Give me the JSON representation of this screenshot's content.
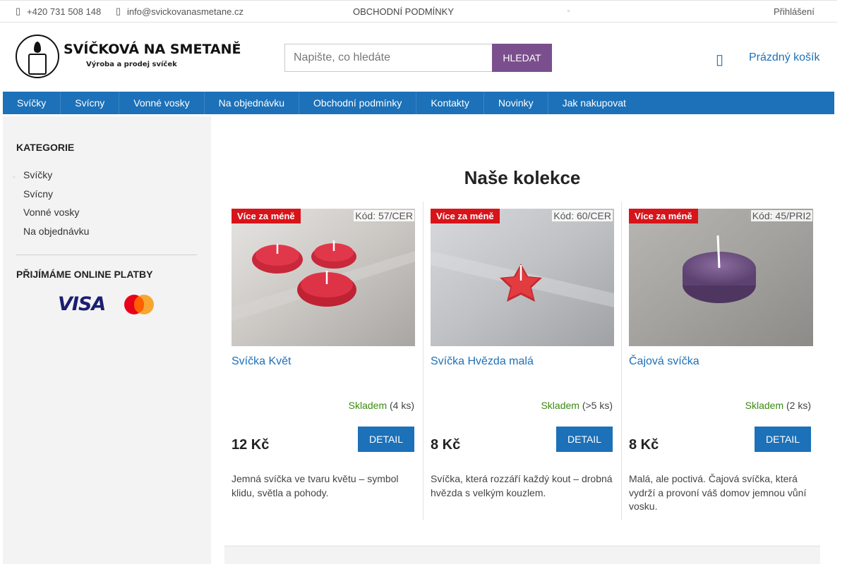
{
  "topbar": {
    "phone": "+420 731 508 148",
    "email": "info@svickovanasmetane.cz",
    "conditions": "OBCHODNÍ PODMÍNKY",
    "login": "Přihlášení"
  },
  "logo": {
    "title": "SVÍČKOVÁ NA SMETANĚ",
    "subtitle": "Výroba a prodej svíček"
  },
  "search": {
    "placeholder": "Napište, co hledáte",
    "button": "HLEDAT"
  },
  "cart": {
    "label": "Prázdný košík"
  },
  "nav": {
    "items": [
      "Svíčky",
      "Svícny",
      "Vonné vosky",
      "Na objednávku",
      "Obchodní podmínky",
      "Kontakty",
      "Novinky",
      "Jak nakupovat"
    ]
  },
  "sidebar": {
    "categories_heading": "KATEGORIE",
    "categories": [
      "Svíčky",
      "Svícny",
      "Vonné vosky",
      "Na objednávku"
    ],
    "payments_heading": "PŘIJÍMÁME ONLINE PLATBY",
    "visa": "VISA"
  },
  "main": {
    "title": "Naše kolekce",
    "products": [
      {
        "flag": "Více za méně",
        "code": "Kód: 57/CER",
        "name": "Svíčka Květ",
        "stock_status": "Skladem",
        "stock_count": "(4 ks)",
        "price": "12 Kč",
        "button": "DETAIL",
        "description": "Jemná svíčka ve tvaru květu – symbol klidu, světla a pohody."
      },
      {
        "flag": "Více za méně",
        "code": "Kód: 60/CER",
        "name": "Svíčka Hvězda malá",
        "stock_status": "Skladem",
        "stock_count": "(>5 ks)",
        "price": "8 Kč",
        "button": "DETAIL",
        "description": "Svíčka, která rozzáří každý kout – drobná hvězda s velkým kouzlem."
      },
      {
        "flag": "Více za méně",
        "code": "Kód: 45/PRI2",
        "name": "Čajová svíčka",
        "stock_status": "Skladem",
        "stock_count": "(2 ks)",
        "price": "8 Kč",
        "button": "DETAIL",
        "description": "Malá, ale poctivá. Čajová svíčka, která vydrží a provoní váš domov jemnou vůní vosku."
      }
    ]
  },
  "colors": {
    "brand_blue": "#1c71b8",
    "search_button": "#7b4f8d",
    "flag_red": "#d7141a",
    "stock_green": "#3a8a12"
  }
}
